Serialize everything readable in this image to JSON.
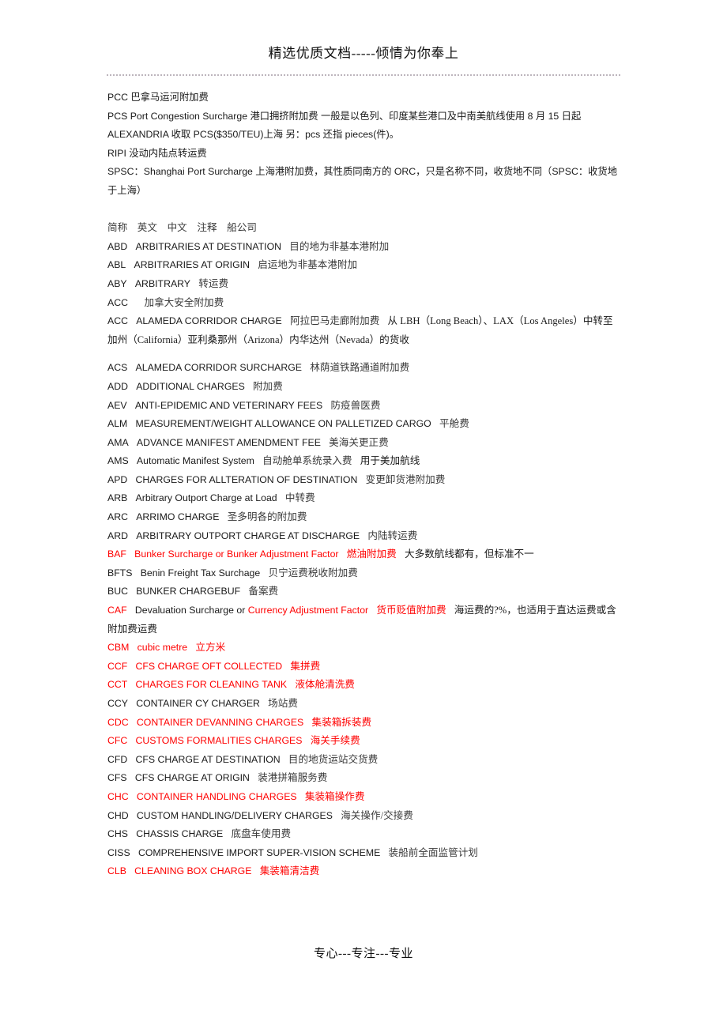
{
  "header": {
    "title": "精选优质文档-----倾情为你奉上"
  },
  "footer": {
    "text": "专心---专注---专业"
  },
  "intro": {
    "lines": [
      {
        "id": "pcc",
        "text": "PCC 巴拿马运河附加费"
      },
      {
        "id": "pcs",
        "text": "PCS Port Congestion Surcharge 港口拥挤附加费 一般是以色列、印度某些港口及中南美航线使用 8 月 15 日起 ALEXANDRIA 收取 PCS($350/TEU)上海 另：pcs 还指 pieces(件)。"
      },
      {
        "id": "ripi",
        "text": "RIPI 没动内陆点转运费"
      },
      {
        "id": "spsc",
        "text": "SPSC：Shanghai Port Surcharge 上海港附加费，其性质同南方的 ORC，只是名称不同，收货地不同（SPSC：收货地于上海）"
      }
    ]
  },
  "glossary": {
    "column_headers": "简称　英文　中文　注释　船公司",
    "rows": [
      {
        "abbr": "ABD",
        "english": "ARBITRARIES AT DESTINATION",
        "chinese": "目的地为非基本港附加",
        "note": "",
        "red": false
      },
      {
        "abbr": "ABL",
        "english": "ARBITRARIES AT ORIGIN",
        "chinese": "启运地为非基本港附加",
        "note": "",
        "red": false
      },
      {
        "abbr": "ABY",
        "english": "ARBITRARY",
        "chinese": "转运费",
        "note": "",
        "red": false
      },
      {
        "abbr": "ACC",
        "english": "",
        "chinese": "加拿大安全附加费",
        "note": "",
        "red": false
      },
      {
        "abbr": "ACC",
        "english": "ALAMEDA CORRIDOR CHARGE",
        "chinese": "阿拉巴马走廊附加费",
        "note": "从 LBH（Long Beach）、LAX（Los Angeles）中转至加州（California）亚利桑那州（Arizona）内华达州（Nevada）的货收",
        "red": false
      },
      {
        "abbr": "ACS",
        "english": "ALAMEDA CORRIDOR SURCHARGE",
        "chinese": "林荫道铁路通道附加费",
        "note": "",
        "red": false
      },
      {
        "abbr": "ADD",
        "english": "ADDITIONAL CHARGES",
        "chinese": "附加费",
        "note": "",
        "red": false
      },
      {
        "abbr": "AEV",
        "english": "ANTI-EPIDEMIC AND VETERINARY FEES",
        "chinese": "防疫兽医费",
        "note": "",
        "red": false
      },
      {
        "abbr": "ALM",
        "english": "MEASUREMENT/WEIGHT ALLOWANCE ON PALLETIZED CARGO",
        "chinese": "平舱费",
        "note": "",
        "red": false
      },
      {
        "abbr": "AMA",
        "english": "ADVANCE MANIFEST AMENDMENT FEE",
        "chinese": "美海关更正费",
        "note": "",
        "red": false
      },
      {
        "abbr": "AMS",
        "english": "Automatic Manifest System",
        "chinese": "自动舱单系统录入费",
        "note": "用于美加航线",
        "red": false
      },
      {
        "abbr": "APD",
        "english": "CHARGES FOR ALLTERATION OF DESTINATION",
        "chinese": "变更卸货港附加费",
        "note": "",
        "red": false
      },
      {
        "abbr": "ARB",
        "english": "Arbitrary Outport Charge at Load",
        "chinese": "中转费",
        "note": "",
        "red": false
      },
      {
        "abbr": "ARC",
        "english": "ARRIMO CHARGE",
        "chinese": "圣多明各的附加费",
        "note": "",
        "red": false
      },
      {
        "abbr": "ARD",
        "english": "ARBITRARY OUTPORT CHARGE AT DISCHARGE",
        "chinese": "内陆转运费",
        "note": "",
        "red": false
      },
      {
        "abbr": "BAF",
        "english": "Bunker Surcharge or Bunker Adjustment Factor",
        "chinese": "燃油附加费",
        "note": "大多数航线都有，但标准不一",
        "red": true
      },
      {
        "abbr": "BFTS",
        "english": "Benin Freight Tax Surchage",
        "chinese": "贝宁运费税收附加费",
        "note": "",
        "red": false
      },
      {
        "abbr": "BUC",
        "english": "BUNKER CHARGEBUF",
        "chinese": "备案费",
        "note": "",
        "red": false
      },
      {
        "abbr": "CAF",
        "english_black": "Devaluation Surcharge or ",
        "english_red": "Currency Adjustment Factor",
        "chinese": "货币贬值附加费",
        "note": "海运费的?%，也适用于直达运费或含附加费运费",
        "red": true,
        "mixed": true
      },
      {
        "abbr": "CBM",
        "english": "cubic metre",
        "chinese": "立方米",
        "note": "",
        "red": true
      },
      {
        "abbr": "CCF",
        "english": "CFS CHARGE OFT COLLECTED",
        "chinese": "集拼费",
        "note": "",
        "red": true
      },
      {
        "abbr": "CCT",
        "english": "CHARGES FOR CLEANING TANK",
        "chinese": "液体舱清洗费",
        "note": "",
        "red": true
      },
      {
        "abbr": "CCY",
        "english": "CONTAINER CY CHARGER",
        "chinese": "场站费",
        "note": "",
        "red": false
      },
      {
        "abbr": "CDC",
        "english": "CONTAINER DEVANNING CHARGES",
        "chinese": "集装箱拆装费",
        "note": "",
        "red": true
      },
      {
        "abbr": "CFC",
        "english": "CUSTOMS FORMALITIES CHARGES",
        "chinese": "海关手续费",
        "note": "",
        "red": true
      },
      {
        "abbr": "CFD",
        "english": "CFS CHARGE AT DESTINATION",
        "chinese": "目的地货运站交货费",
        "note": "",
        "red": false
      },
      {
        "abbr": "CFS",
        "english": "CFS CHARGE AT ORIGIN",
        "chinese": "装港拼箱服务费",
        "note": "",
        "red": false
      },
      {
        "abbr": "CHC",
        "english": "CONTAINER HANDLING CHARGES",
        "chinese": "集装箱操作费",
        "note": "",
        "red": true
      },
      {
        "abbr": "CHD",
        "english": "CUSTOM HANDLING/DELIVERY CHARGES",
        "chinese": "海关操作/交接费",
        "note": "",
        "red": false
      },
      {
        "abbr": "CHS",
        "english": "CHASSIS CHARGE",
        "chinese": "底盘车使用费",
        "note": "",
        "red": false
      },
      {
        "abbr": "CISS",
        "english": "COMPREHENSIVE IMPORT SUPER-VISION SCHEME",
        "chinese": "装船前全面监管计划",
        "note": "",
        "red": false
      },
      {
        "abbr": "CLB",
        "english": "CLEANING BOX CHARGE",
        "chinese": "集装箱清洁费",
        "note": "",
        "red": true
      }
    ]
  },
  "colors": {
    "highlight": "#ff0000",
    "body_text": "#1a1a1a",
    "chinese_text": "#3a3a3a",
    "rule": "#bdb5bd"
  }
}
